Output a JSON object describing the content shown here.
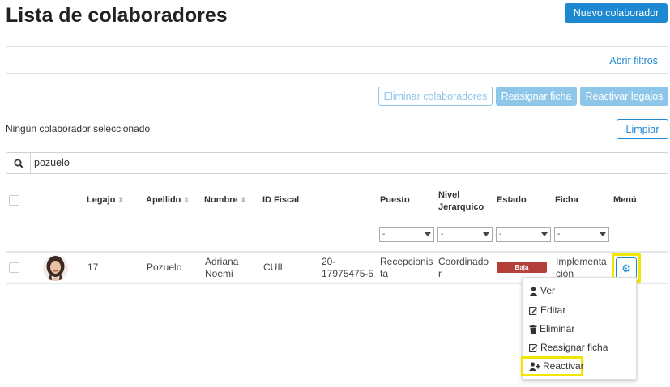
{
  "page": {
    "title": "Lista de colaboradores"
  },
  "header": {
    "new_button": "Nuevo colaborador"
  },
  "filters": {
    "open_filters": "Abrir filtros"
  },
  "actions": {
    "delete": "Eliminar colaboradores",
    "reassign": "Reasignar ficha",
    "reactivate": "Reactivar legajos"
  },
  "selection": {
    "status": "Ningún colaborador seleccionado",
    "clear": "Limpiar"
  },
  "search": {
    "value": "pozuelo"
  },
  "table": {
    "headers": {
      "legajo": "Legajo",
      "apellido": "Apellido",
      "nombre": "Nombre",
      "id_fiscal": "ID Fiscal",
      "puesto": "Puesto",
      "nivel_1": "Nivel",
      "nivel_2": "Jerarquico",
      "estado": "Estado",
      "ficha": "Ficha",
      "menu": "Menú"
    },
    "filter_default": "-",
    "row": {
      "legajo": "17",
      "apellido": "Pozuelo",
      "nombre_1": "Adriana",
      "nombre_2": "Noemi",
      "id_type": "CUIL",
      "id_1": "20-",
      "id_2": "17975475-5",
      "puesto_1": "Recepcionis",
      "puesto_2": "ta",
      "nivel_1": "Coordinado",
      "nivel_2": "r",
      "estado": "Baja",
      "ficha_1": "Implementa",
      "ficha_2": "ción"
    }
  },
  "menu": {
    "items": [
      "Ver",
      "Editar",
      "Eliminar",
      "Reasignar ficha",
      "Reactivar"
    ]
  },
  "colors": {
    "primary": "#1e88d2",
    "light": "#8ec6ea",
    "danger": "#b5403a",
    "highlight": "#f2e600"
  }
}
